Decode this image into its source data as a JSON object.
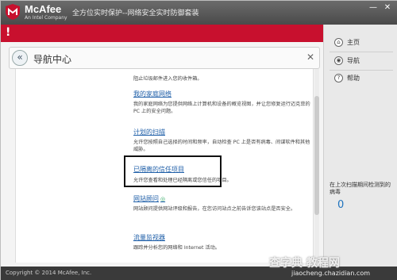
{
  "titlebar": {
    "brand": "McAfee",
    "brand_sub": "An Intel Company",
    "title": "全方位实时保护--网络安全实时防御套装",
    "min": "—",
    "close": "✕"
  },
  "alert": {
    "mark": "!"
  },
  "nav": {
    "back": "«",
    "title": "导航中心",
    "close": "✕"
  },
  "items": [
    {
      "link": "",
      "desc": "阻止垃圾邮件进入您的收件箱。"
    },
    {
      "link": "我的家庭网络",
      "desc": "我的家庭网络为您提供网络上计算机和设备的概览视图，并让您修复运行迈克菲的 PC 上的安全问题。"
    },
    {
      "link": "计划的扫描",
      "desc": "允许您按照自己选择的时间和频率，自动检查 PC 上是否有病毒、间谍软件和其他威胁。"
    },
    {
      "link": "已隔离的信任项目",
      "desc": "允许您查看和处理已经隔离或您信任的项目。"
    },
    {
      "link": "网站顾问",
      "desc": "网站顾问提供网站评级和报告，在您访问站点之前告诉您该站点是否安全。"
    },
    {
      "link": "流量监视器",
      "desc": "跟踪并分析您的网络和 Internet 活动。"
    }
  ],
  "sidebar": {
    "items": [
      {
        "icon": "home-icon",
        "label": "主页"
      },
      {
        "icon": "compass-icon",
        "label": "导航"
      },
      {
        "icon": "help-icon",
        "label": "帮助"
      }
    ],
    "stat_label": "在上次扫描期间检测到的病毒",
    "stat_value": "0"
  },
  "footer": {
    "copyright": "Copyright © 2014 McAfee, Inc."
  },
  "watermark": {
    "text": "查字典 教程网",
    "sub": "jiaocheng.chazidian.com"
  },
  "colors": {
    "accent": "#c8102e",
    "link": "#1f5fa8",
    "stat": "#1e73be"
  }
}
